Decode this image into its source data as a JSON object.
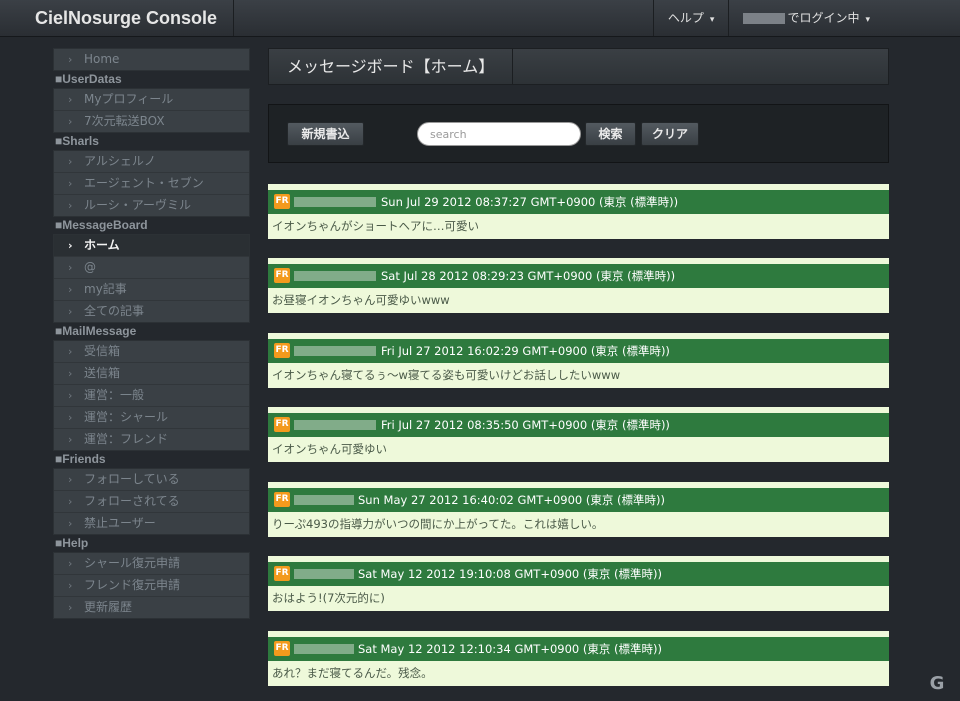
{
  "app": {
    "title": "CielNosurge Console"
  },
  "nav": {
    "help_label": "ヘルプ",
    "login_label": "でログイン中",
    "caret": "▾"
  },
  "sidebar": {
    "home": "Home",
    "sections": [
      {
        "title": "■UserDatas",
        "items": [
          "Myプロフィール",
          "7次元転送BOX"
        ]
      },
      {
        "title": "■Sharls",
        "items": [
          "アルシェルノ",
          "エージェント・セブン",
          "ルーシ・アーヴミル"
        ]
      },
      {
        "title": "■MessageBoard",
        "items": [
          "ホーム",
          "@",
          "my記事",
          "全ての記事"
        ]
      },
      {
        "title": "■MailMessage",
        "items": [
          "受信箱",
          "送信箱",
          "運営：一般",
          "運営：シャール",
          "運営：フレンド"
        ]
      },
      {
        "title": "■Friends",
        "items": [
          "フォローしている",
          "フォローされてる",
          "禁止ユーザー"
        ]
      },
      {
        "title": "■Help",
        "items": [
          "シャール復元申請",
          "フレンド復元申請",
          "更新履歴"
        ]
      }
    ]
  },
  "page": {
    "title": "メッセージボード【ホーム】"
  },
  "actions": {
    "new_post": "新規書込",
    "search_placeholder": "search",
    "search_button": "検索",
    "clear_button": "クリア"
  },
  "messages": [
    {
      "badge": "FR",
      "time": "Sun Jul 29 2012 08:37:27 GMT+0900 (東京 (標準時))",
      "text": "イオンちゃんがショートヘアに…可愛い"
    },
    {
      "badge": "FR",
      "time": "Sat Jul 28 2012 08:29:23 GMT+0900 (東京 (標準時))",
      "text": "お昼寝イオンちゃん可愛ゆいwww"
    },
    {
      "badge": "FR",
      "time": "Fri Jul 27 2012 16:02:29 GMT+0900 (東京 (標準時))",
      "text": "イオンちゃん寝てるぅ～w寝てる姿も可愛いけどお話ししたいwww"
    },
    {
      "badge": "FR",
      "time": "Fri Jul 27 2012 08:35:50 GMT+0900 (東京 (標準時))",
      "text": "イオンちゃん可愛ゆい"
    },
    {
      "badge": "FR",
      "time": "Sun May 27 2012 16:40:02 GMT+0900 (東京 (標準時))",
      "text": "りーぷ493の指導力がいつの間にか上がってた。これは嬉しい。"
    },
    {
      "badge": "FR",
      "time": "Sat May 12 2012 19:10:08 GMT+0900 (東京 (標準時))",
      "text": "おはよう!(7次元的に)"
    },
    {
      "badge": "FR",
      "time": "Sat May 12 2012 12:10:34 GMT+0900 (東京 (標準時))",
      "text": "あれ？まだ寝てるんだ。残念。"
    }
  ],
  "colors": {
    "message_header": "#2e7a3e",
    "message_body": "#eef9da",
    "badge": "#f39a1d",
    "background": "#24282d"
  }
}
